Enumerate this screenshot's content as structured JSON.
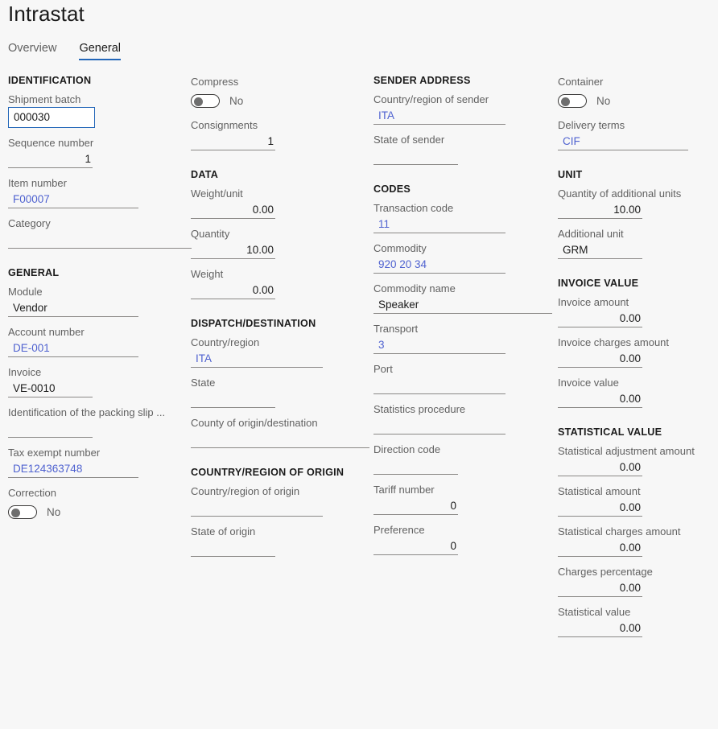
{
  "header": {
    "title": "Intrastat"
  },
  "tabs": [
    {
      "label": "Overview",
      "active": false
    },
    {
      "label": "General",
      "active": true
    }
  ],
  "columns": {
    "col1": {
      "sections": [
        {
          "heading": "IDENTIFICATION",
          "fields": [
            {
              "label": "Shipment batch",
              "value": "000030",
              "kind": "input"
            },
            {
              "label": "Sequence number",
              "value": "1",
              "kind": "number"
            },
            {
              "label": "Item number",
              "value": "F00007",
              "kind": "link"
            },
            {
              "label": "Category",
              "value": "",
              "kind": "text"
            }
          ]
        },
        {
          "heading": "GENERAL",
          "fields": [
            {
              "label": "Module",
              "value": "Vendor",
              "kind": "text"
            },
            {
              "label": "Account number",
              "value": "DE-001",
              "kind": "link"
            },
            {
              "label": "Invoice",
              "value": "VE-0010",
              "kind": "text"
            },
            {
              "label": "Identification of the packing slip ...",
              "value": "",
              "kind": "text"
            },
            {
              "label": "Tax exempt number",
              "value": "DE124363748",
              "kind": "link"
            },
            {
              "label": "Correction",
              "value": "No",
              "kind": "toggle"
            }
          ]
        }
      ]
    },
    "col2": {
      "sections": [
        {
          "heading": "",
          "fields": [
            {
              "label": "Compress",
              "value": "No",
              "kind": "toggle"
            },
            {
              "label": "Consignments",
              "value": "1",
              "kind": "number"
            }
          ]
        },
        {
          "heading": "DATA",
          "fields": [
            {
              "label": "Weight/unit",
              "value": "0.00",
              "kind": "number"
            },
            {
              "label": "Quantity",
              "value": "10.00",
              "kind": "number"
            },
            {
              "label": "Weight",
              "value": "0.00",
              "kind": "number"
            }
          ]
        },
        {
          "heading": "DISPATCH/DESTINATION",
          "fields": [
            {
              "label": "Country/region",
              "value": "ITA",
              "kind": "link"
            },
            {
              "label": "State",
              "value": "",
              "kind": "text"
            },
            {
              "label": "County of origin/destination",
              "value": "",
              "kind": "text"
            }
          ]
        },
        {
          "heading": "COUNTRY/REGION OF ORIGIN",
          "fields": [
            {
              "label": "Country/region of origin",
              "value": "",
              "kind": "text"
            },
            {
              "label": "State of origin",
              "value": "",
              "kind": "text"
            }
          ]
        }
      ]
    },
    "col3": {
      "sections": [
        {
          "heading": "SENDER ADDRESS",
          "fields": [
            {
              "label": "Country/region of sender",
              "value": "ITA",
              "kind": "link"
            },
            {
              "label": "State of sender",
              "value": "",
              "kind": "text"
            }
          ]
        },
        {
          "heading": "CODES",
          "fields": [
            {
              "label": "Transaction code",
              "value": "11",
              "kind": "link"
            },
            {
              "label": "Commodity",
              "value": "920 20 34",
              "kind": "link"
            },
            {
              "label": "Commodity name",
              "value": "Speaker",
              "kind": "text"
            },
            {
              "label": "Transport",
              "value": "3",
              "kind": "link"
            },
            {
              "label": "Port",
              "value": "",
              "kind": "text"
            },
            {
              "label": "Statistics procedure",
              "value": "",
              "kind": "text"
            },
            {
              "label": "Direction code",
              "value": "",
              "kind": "text"
            },
            {
              "label": "Tariff number",
              "value": "0",
              "kind": "number"
            },
            {
              "label": "Preference",
              "value": "0",
              "kind": "number"
            }
          ]
        }
      ]
    },
    "col4": {
      "sections": [
        {
          "heading": "",
          "fields": [
            {
              "label": "Container",
              "value": "No",
              "kind": "toggle"
            },
            {
              "label": "Delivery terms",
              "value": "CIF",
              "kind": "link"
            }
          ]
        },
        {
          "heading": "UNIT",
          "fields": [
            {
              "label": "Quantity of additional units",
              "value": "10.00",
              "kind": "number"
            },
            {
              "label": "Additional unit",
              "value": "GRM",
              "kind": "text"
            }
          ]
        },
        {
          "heading": "INVOICE VALUE",
          "fields": [
            {
              "label": "Invoice amount",
              "value": "0.00",
              "kind": "number"
            },
            {
              "label": "Invoice charges amount",
              "value": "0.00",
              "kind": "number"
            },
            {
              "label": "Invoice value",
              "value": "0.00",
              "kind": "number"
            }
          ]
        },
        {
          "heading": "STATISTICAL VALUE",
          "fields": [
            {
              "label": "Statistical adjustment amount",
              "value": "0.00",
              "kind": "number"
            },
            {
              "label": "Statistical amount",
              "value": "0.00",
              "kind": "number"
            },
            {
              "label": "Statistical charges amount",
              "value": "0.00",
              "kind": "number"
            },
            {
              "label": "Charges percentage",
              "value": "0.00",
              "kind": "number"
            },
            {
              "label": "Statistical value",
              "value": "0.00",
              "kind": "number"
            }
          ]
        }
      ]
    }
  },
  "colors": {
    "accent": "#2266b8",
    "link": "#4f62d0",
    "background": "#f7f7f7",
    "label": "#616161",
    "underline": "#8a8886"
  }
}
